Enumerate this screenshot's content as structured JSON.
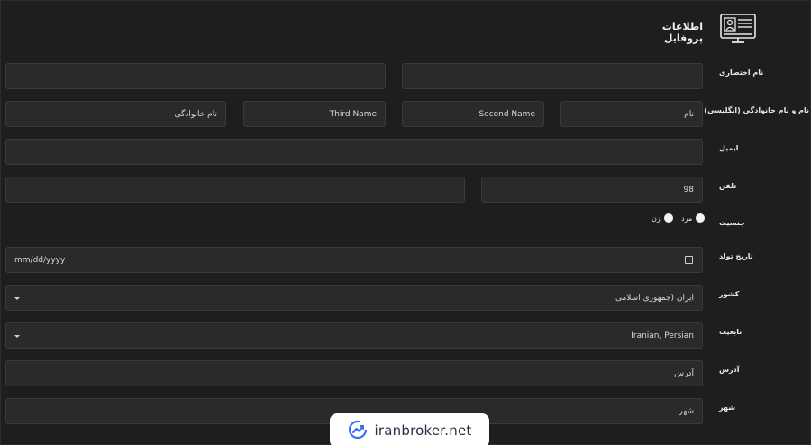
{
  "header": {
    "title": "اطلاعات پروفایل",
    "icon": "profile-monitor-icon"
  },
  "labels": {
    "nickname": "نام اختصاری",
    "english_name": "نام و نام خانوادگی (انگلیسی)",
    "email": "ایمیل",
    "phone": "تلفن",
    "gender": "جنسیت",
    "birthdate": "تاریخ تولد",
    "country": "کشور",
    "nationality": "تابعیت",
    "address": "آدرس",
    "city": "شهر"
  },
  "fields": {
    "nickname_left": "",
    "nickname_right": "",
    "first_name": "نام",
    "second_name": "Second Name",
    "third_name": "Third Name",
    "last_name": "نام خانوادگی",
    "email": "",
    "phone_code": "98",
    "phone_number": "",
    "birthdate_placeholder": "mm/dd/yyyy",
    "country": "ایران (جمهوری اسلامی",
    "nationality": "Iranian, Persian",
    "address": "آدرس",
    "city": "شهر"
  },
  "gender": {
    "male": "مرد",
    "female": "زن"
  },
  "watermark": {
    "text": "iranbroker.net",
    "brand_color": "#3b6ff5"
  }
}
